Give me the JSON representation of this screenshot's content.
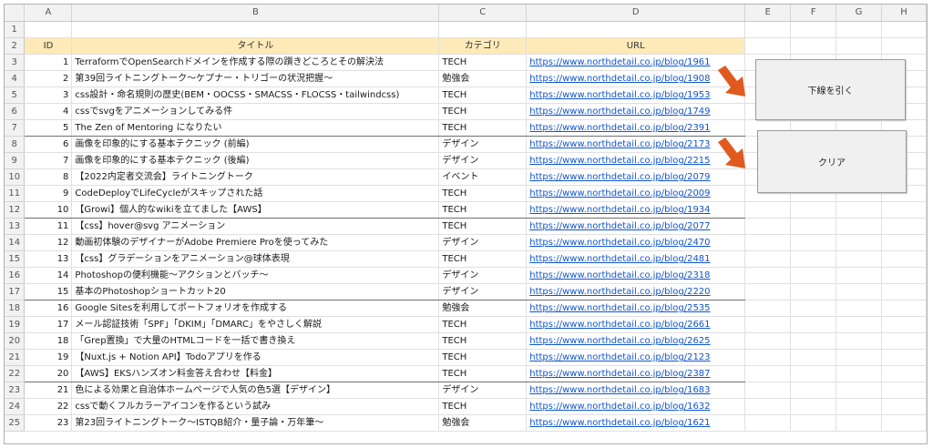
{
  "columns": [
    "A",
    "B",
    "C",
    "D",
    "E",
    "F",
    "G",
    "H"
  ],
  "row_numbers": [
    "1",
    "2",
    "3",
    "4",
    "5",
    "6",
    "7",
    "8",
    "9",
    "10",
    "11",
    "12",
    "13",
    "14",
    "15",
    "16",
    "17",
    "18",
    "19",
    "20",
    "21",
    "22",
    "23",
    "24",
    "25"
  ],
  "header": {
    "id": "ID",
    "title": "タイトル",
    "category": "カテゴリ",
    "url": "URL"
  },
  "rows": [
    {
      "id": "1",
      "title": "TerraformでOpenSearchドメインを作成する際の躓きどころとその解決法",
      "category": "TECH",
      "url": "https://www.northdetail.co.jp/blog/1961"
    },
    {
      "id": "2",
      "title": "第39回ライトニングトーク～ケプナー・トリゴーの状況把握～",
      "category": "勉強会",
      "url": "https://www.northdetail.co.jp/blog/1908"
    },
    {
      "id": "3",
      "title": "css設計・命名規則の歴史(BEM・OOCSS・SMACSS・FLOCSS・tailwindcss)",
      "category": "TECH",
      "url": "https://www.northdetail.co.jp/blog/1953"
    },
    {
      "id": "4",
      "title": "cssでsvgをアニメーションしてみる件",
      "category": "TECH",
      "url": "https://www.northdetail.co.jp/blog/1749"
    },
    {
      "id": "5",
      "title": "The Zen of Mentoring になりたい",
      "category": "TECH",
      "url": "https://www.northdetail.co.jp/blog/2391"
    },
    {
      "id": "6",
      "title": "画像を印象的にする基本テクニック (前編)",
      "category": "デザイン",
      "url": "https://www.northdetail.co.jp/blog/2173"
    },
    {
      "id": "7",
      "title": "画像を印象的にする基本テクニック (後編)",
      "category": "デザイン",
      "url": "https://www.northdetail.co.jp/blog/2215"
    },
    {
      "id": "8",
      "title": "【2022内定者交流会】ライトニングトーク",
      "category": "イベント",
      "url": "https://www.northdetail.co.jp/blog/2079"
    },
    {
      "id": "9",
      "title": "CodeDeployでLifeCycleがスキップされた話",
      "category": "TECH",
      "url": "https://www.northdetail.co.jp/blog/2009"
    },
    {
      "id": "10",
      "title": "【Growi】個人的なwikiを立てました【AWS】",
      "category": "TECH",
      "url": "https://www.northdetail.co.jp/blog/1934"
    },
    {
      "id": "11",
      "title": "【css】hover@svg アニメーション",
      "category": "TECH",
      "url": "https://www.northdetail.co.jp/blog/2077"
    },
    {
      "id": "12",
      "title": "動画初体験のデザイナーがAdobe Premiere Proを使ってみた",
      "category": "デザイン",
      "url": "https://www.northdetail.co.jp/blog/2470"
    },
    {
      "id": "13",
      "title": "【css】グラデーションをアニメーション@球体表現",
      "category": "TECH",
      "url": "https://www.northdetail.co.jp/blog/2481"
    },
    {
      "id": "14",
      "title": "Photoshopの便利機能～アクションとバッチ～",
      "category": "デザイン",
      "url": "https://www.northdetail.co.jp/blog/2318"
    },
    {
      "id": "15",
      "title": "基本のPhotoshopショートカット20",
      "category": "デザイン",
      "url": "https://www.northdetail.co.jp/blog/2220"
    },
    {
      "id": "16",
      "title": "Google Sitesを利用してポートフォリオを作成する",
      "category": "勉強会",
      "url": "https://www.northdetail.co.jp/blog/2535"
    },
    {
      "id": "17",
      "title": "メール認証技術「SPF」「DKIM」「DMARC」をやさしく解説",
      "category": "TECH",
      "url": "https://www.northdetail.co.jp/blog/2661"
    },
    {
      "id": "18",
      "title": "「Grep置換」で大量のHTMLコードを一括で書き換え",
      "category": "TECH",
      "url": "https://www.northdetail.co.jp/blog/2625"
    },
    {
      "id": "19",
      "title": "【Nuxt.js + Notion API】Todoアプリを作る",
      "category": "TECH",
      "url": "https://www.northdetail.co.jp/blog/2123"
    },
    {
      "id": "20",
      "title": "【AWS】EKSハンズオン料金答え合わせ【料金】",
      "category": "TECH",
      "url": "https://www.northdetail.co.jp/blog/2387"
    },
    {
      "id": "21",
      "title": "色による効果と自治体ホームページで人気の色5選【デザイン】",
      "category": "デザイン",
      "url": "https://www.northdetail.co.jp/blog/1683"
    },
    {
      "id": "22",
      "title": "cssで動くフルカラーアイコンを作るという試み",
      "category": "TECH",
      "url": "https://www.northdetail.co.jp/blog/1632"
    },
    {
      "id": "23",
      "title": "第23回ライトニングトーク～ISTQB紹介・量子論・万年筆～",
      "category": "勉強会",
      "url": "https://www.northdetail.co.jp/blog/1621"
    }
  ],
  "buttons": {
    "underline": "下線を引く",
    "clear": "クリア"
  },
  "icons": {
    "arrow": "arrow-right-down-icon"
  },
  "colors": {
    "header_fill": "#fdeab8",
    "link": "#1155cc",
    "arrow": "#e05a1e"
  }
}
